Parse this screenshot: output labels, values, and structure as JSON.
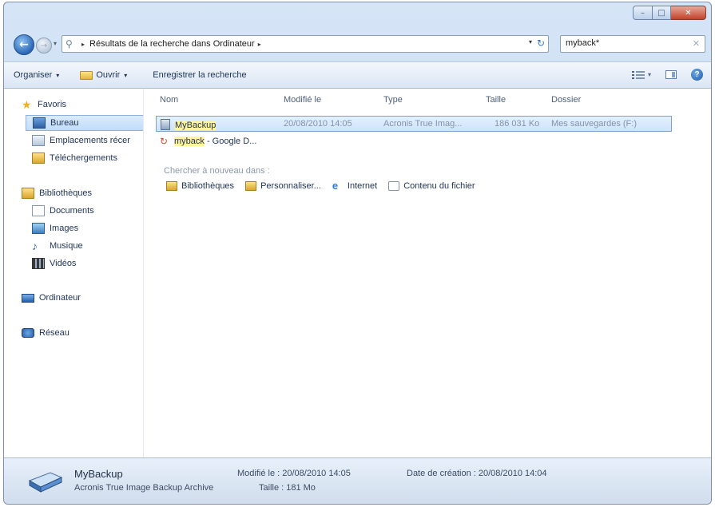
{
  "window": {
    "buttons": {
      "minimize": "–",
      "maximize": "□",
      "close": "✕"
    }
  },
  "address_bar": {
    "back": "←",
    "forward": "→",
    "path_arrow": "▸",
    "path": "Résultats de la recherche dans Ordinateur",
    "path_arrow_end": "▸",
    "dropdown": "▾",
    "refresh": "↻"
  },
  "search": {
    "value": "myback*",
    "clear": "✕"
  },
  "toolbar": {
    "organize": "Organiser",
    "open": "Ouvrir",
    "save_search": "Enregistrer la recherche",
    "caret": "▾"
  },
  "sidebar": {
    "favorites": "Favoris",
    "desktop": "Bureau",
    "recent": "Emplacements récer",
    "downloads": "Téléchergements",
    "libraries": "Bibliothèques",
    "documents": "Documents",
    "images": "Images",
    "music": "Musique",
    "videos": "Vidéos",
    "computer": "Ordinateur",
    "network": "Réseau"
  },
  "columns": {
    "name": "Nom",
    "modified": "Modifié le",
    "type": "Type",
    "size": "Taille",
    "folder": "Dossier"
  },
  "results": [
    {
      "name": "MyBackup",
      "modified": "20/08/2010 14:05",
      "type": "Acronis True Imag...",
      "size": "186 031 Ko",
      "folder": "Mes sauvegardes (F:)"
    },
    {
      "name_highlight": "myback",
      "name_rest": " - Google D..."
    }
  ],
  "search_again": {
    "label": "Chercher à nouveau dans :",
    "libraries": "Bibliothèques",
    "custom": "Personnaliser...",
    "internet": "Internet",
    "file_contents": "Contenu du fichier"
  },
  "details": {
    "name": "MyBackup",
    "type": "Acronis True Image Backup Archive",
    "modified": "Modifié le : 20/08/2010 14:05",
    "size": "Taille : 181 Mo",
    "created": "Date de création : 20/08/2010 14:04"
  },
  "icons": {
    "favorites": "star-icon",
    "help": "?"
  },
  "colors": {
    "selection": "#cfe3fb",
    "highlight": "#fff49a",
    "close_button": "#c2422b"
  }
}
